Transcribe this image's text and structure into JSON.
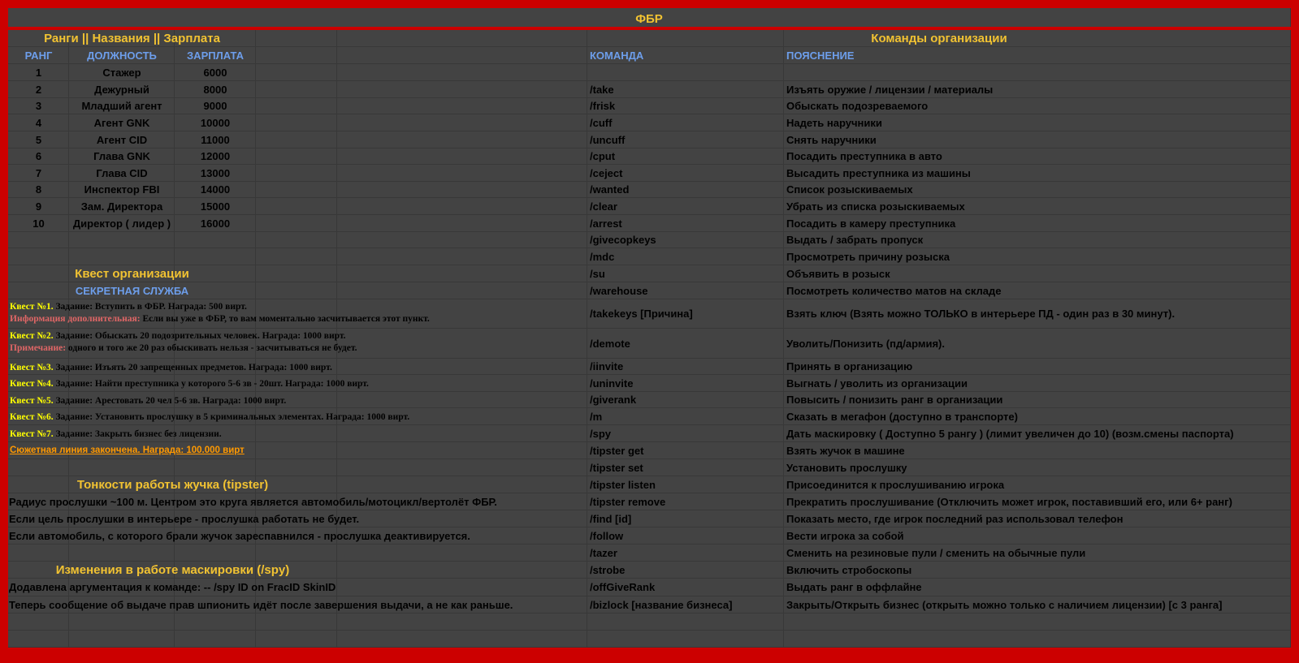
{
  "title": "ФБР",
  "left": {
    "header": "Ранги || Названия || Зарплата",
    "columns": [
      "РАНГ",
      "ДОЛЖНОСТЬ",
      "ЗАРПЛАТА"
    ],
    "ranks": [
      [
        "1",
        "Стажер",
        "6000"
      ],
      [
        "2",
        "Дежурный",
        "8000"
      ],
      [
        "3",
        "Младший агент",
        "9000"
      ],
      [
        "4",
        "Агент GNK",
        "10000"
      ],
      [
        "5",
        "Агент CID",
        "11000"
      ],
      [
        "6",
        "Глава GNK",
        "12000"
      ],
      [
        "7",
        "Глава CID",
        "13000"
      ],
      [
        "8",
        "Инспектор FBI",
        "14000"
      ],
      [
        "9",
        "Зам. Директора",
        "15000"
      ],
      [
        "10",
        "Директор ( лидер )",
        "16000"
      ]
    ],
    "quest_header": "Квест организации",
    "quest_subheader": "СЕКРЕТНАЯ СЛУЖБА",
    "quests": [
      {
        "label": "Квест №1.",
        "text": " Задание: Вступить в ФБР. Награда: 500 вирт.",
        "note_label": "Информация дополнительная:",
        "note_text": " Если вы уже в ФБР, то вам моментально засчитывается этот пункт."
      },
      {
        "label": "Квест №2.",
        "text": " Задание: Обыскать 20 подозрительных человек. Награда: 1000 вирт.",
        "note_label": "Примечание:",
        "note_text": " одного и того же 20 раз обыскивать нельзя - засчитываться не будет."
      },
      {
        "label": "Квест №3.",
        "text": " Задание: Изъять 20 запрещенных предметов. Награда: 1000 вирт."
      },
      {
        "label": "Квест №4.",
        "text": " Задание: Найти преступника у которого 5-6 зв - 20шт. Награда: 1000 вирт."
      },
      {
        "label": "Квест №5.",
        "text": " Задание: Арестовать 20 чел 5-6 зв. Награда: 1000 вирт."
      },
      {
        "label": "Квест №6.",
        "text": " Задание: Установить прослушку в 5 криминальных элементах. Награда: 1000 вирт."
      },
      {
        "label": "Квест №7.",
        "text": " Задание: Закрыть бизнес без лицензии."
      }
    ],
    "story_end": "Сюжетная линия закончена. Награда: 100.000 вирт",
    "tipster_header": "Тонкости работы жучка (tipster)",
    "tipster_notes": [
      "Радиус прослушки ~100 м. Центром это круга является автомобиль/мотоцикл/вертолёт ФБР.",
      "Если цель прослушки в интерьере - прослушка работать не будет.",
      "Если автомобиль, с которого брали жучок зареспавнился - прослушка деактивируется."
    ],
    "spy_header": "Изменения в работе маскировки (/spy)",
    "spy_notes": [
      "Додавлена аргументация к команде: -- /spy ID on FracID SkinID",
      "Теперь сообщение об выдаче прав шпионить идёт после завершения выдачи, а не как раньше."
    ]
  },
  "right": {
    "header": "Команды организации",
    "columns": [
      "КОМАНДА",
      "ПОЯСНЕНИЕ"
    ],
    "commands": [
      [
        "/take",
        "Изъять оружие / лицензии / материалы"
      ],
      [
        "/frisk",
        "Обыскать подозреваемого"
      ],
      [
        "/cuff",
        "Надеть наручники"
      ],
      [
        "/uncuff",
        "Снять наручники"
      ],
      [
        "/cput",
        "Посадить преступника в авто"
      ],
      [
        "/ceject",
        "Высадить преступника из машины"
      ],
      [
        "/wanted",
        "Список розыскиваемых"
      ],
      [
        "/clear",
        "Убрать из списка розыскиваемых"
      ],
      [
        "/arrest",
        "Посадить в камеру преступника"
      ],
      [
        "/givecopkeys",
        "Выдать / забрать пропуск"
      ],
      [
        "/mdc",
        "Просмотреть причину розыска"
      ],
      [
        "/su",
        "Объявить в розыск"
      ],
      [
        "/warehouse",
        "Посмотреть количество матов на складе"
      ],
      [
        "/takekeys [Причина]",
        "Взять ключ (Взять можно ТОЛЬКО в интерьере ПД - один раз в 30 минут)."
      ],
      [
        "/demote",
        "Уволить/Понизить (пд/армия)."
      ],
      [
        "/iinvite",
        "Принять в организацию"
      ],
      [
        "/uninvite",
        "Выгнать / уволить из организации"
      ],
      [
        "/giverank",
        "Повысить / понизить ранг в организации"
      ],
      [
        "/m",
        "Сказать в мегафон (доступно в транспорте)"
      ],
      [
        "/spy",
        "Дать маскировку ( Доступно 5 рангу ) (лимит увеличен до 10) (возм.смены паспорта)"
      ],
      [
        "/tipster get",
        "Взять жучок в машине"
      ],
      [
        "/tipster set",
        "Установить прослушку"
      ],
      [
        "/tipster listen",
        "Присоединится к прослушиванию игрока"
      ],
      [
        "/tipster remove",
        "Прекратить прослушивание (Отключить может игрок, поставивший его, или 6+ ранг)"
      ],
      [
        "/find [id]",
        "Показать место, где игрок последний раз использовал телефон"
      ],
      [
        "/follow",
        "Вести игрока за собой"
      ],
      [
        "/tazer",
        "Сменить на резиновые пули / сменить на обычные пули"
      ],
      [
        "/strobe",
        "Включить стробоскопы"
      ],
      [
        "/offGiveRank",
        "Выдать ранг в оффлайне"
      ],
      [
        "/bizlock [название бизнеса]",
        "Закрыть/Открыть бизнес (открыть можно только с наличием лицензии) [с 3 ранга]"
      ]
    ]
  },
  "colors": {
    "background": "#434343",
    "frame": "#cc0000",
    "header": "#f1c232",
    "column_header": "#6d9eeb",
    "quest_label": "#ffff00",
    "note_label": "#e06666",
    "story_end": "#ff9900"
  }
}
